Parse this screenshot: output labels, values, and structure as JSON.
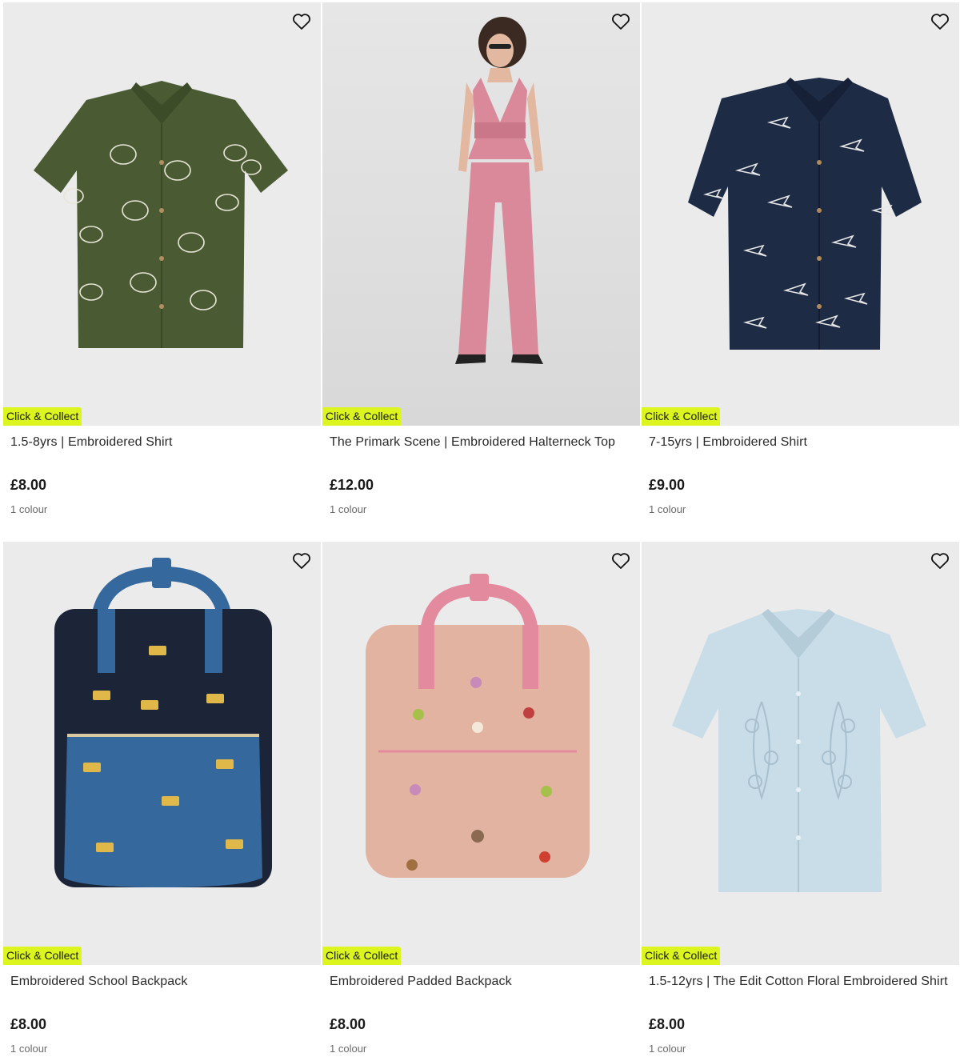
{
  "products": [
    {
      "title": "1.5-8yrs | Embroidered Shirt",
      "price": "£8.00",
      "colours": "1 colour",
      "badge": "Click & Collect",
      "icon": "heart-icon"
    },
    {
      "title": "The Primark Scene | Embroidered Halterneck Top",
      "price": "£12.00",
      "colours": "1 colour",
      "badge": "Click & Collect",
      "icon": "heart-icon"
    },
    {
      "title": "7-15yrs | Embroidered Shirt",
      "price": "£9.00",
      "colours": "1 colour",
      "badge": "Click & Collect",
      "icon": "heart-icon"
    },
    {
      "title": "Embroidered School Backpack",
      "price": "£8.00",
      "colours": "1 colour",
      "badge": "Click & Collect",
      "icon": "heart-icon"
    },
    {
      "title": "Embroidered Padded Backpack",
      "price": "£8.00",
      "colours": "1 colour",
      "badge": "Click & Collect",
      "icon": "heart-icon"
    },
    {
      "title": "1.5-12yrs | The Edit Cotton Floral Embroidered Shirt",
      "price": "£8.00",
      "colours": "1 colour",
      "badge": "Click & Collect",
      "icon": "heart-icon"
    }
  ],
  "colors": {
    "badge_bg": "#dcf51e",
    "shirt_green": "#4a5a32",
    "outfit_pink": "#d9899a",
    "shirt_navy": "#1e2b45",
    "backpack_navy": "#1c2438",
    "backpack_blue": "#35689c",
    "backpack_pink": "#e3b3a2",
    "shirt_lightblue": "#c9dde8"
  }
}
